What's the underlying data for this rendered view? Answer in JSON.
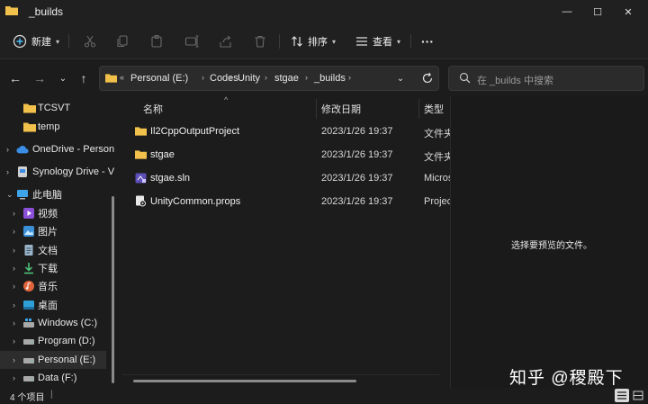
{
  "window": {
    "title": "_builds",
    "minimize_glyph": "—",
    "maximize_glyph": "☐",
    "close_glyph": "✕"
  },
  "toolbar": {
    "new_label": "新建",
    "sort_label": "排序",
    "view_label": "查看",
    "more_label": "···"
  },
  "address": {
    "overflow": "«",
    "crumbs": [
      "Personal (E:)",
      "Codes",
      "Unity",
      "stgae",
      "_builds"
    ]
  },
  "search": {
    "placeholder": "在 _builds 中搜索"
  },
  "sidebar": {
    "items": [
      {
        "label": "TCSVT",
        "icon": "folder-icon"
      },
      {
        "label": "temp",
        "icon": "folder-icon"
      },
      {
        "label": "OneDrive - Person",
        "icon": "cloud-icon"
      },
      {
        "label": "Synology Drive - V",
        "icon": "sync-drive-icon"
      },
      {
        "label": "此电脑",
        "icon": "computer-icon"
      },
      {
        "label": "视频",
        "icon": "video-icon"
      },
      {
        "label": "图片",
        "icon": "picture-icon"
      },
      {
        "label": "文档",
        "icon": "document-icon"
      },
      {
        "label": "下载",
        "icon": "download-icon"
      },
      {
        "label": "音乐",
        "icon": "music-icon"
      },
      {
        "label": "桌面",
        "icon": "desktop-icon"
      },
      {
        "label": "Windows (C:)",
        "icon": "drive-icon"
      },
      {
        "label": "Program (D:)",
        "icon": "drive-icon"
      },
      {
        "label": "Personal (E:)",
        "icon": "drive-icon",
        "selected": true
      },
      {
        "label": "Data (F:)",
        "icon": "drive-icon"
      }
    ]
  },
  "columns": {
    "name": "名称",
    "date": "修改日期",
    "type": "类型"
  },
  "files": [
    {
      "name": "Il2CppOutputProject",
      "date": "2023/1/26 19:37",
      "type": "文件夹",
      "icon": "folder-icon"
    },
    {
      "name": "stgae",
      "date": "2023/1/26 19:37",
      "type": "文件夹",
      "icon": "folder-icon"
    },
    {
      "name": "stgae.sln",
      "date": "2023/1/26 19:37",
      "type": "Microsoft",
      "icon": "solution-file-icon"
    },
    {
      "name": "UnityCommon.props",
      "date": "2023/1/26 19:37",
      "type": "Project",
      "icon": "props-file-icon"
    }
  ],
  "preview": {
    "message": "选择要预览的文件。"
  },
  "status": {
    "item_count": "4 个项目",
    "divider": "|"
  },
  "watermark": "知乎 @稷殿下",
  "colors": {
    "folder": "#f2c14b",
    "accent": "#4cc2ff",
    "background": "#1c1c1c"
  }
}
